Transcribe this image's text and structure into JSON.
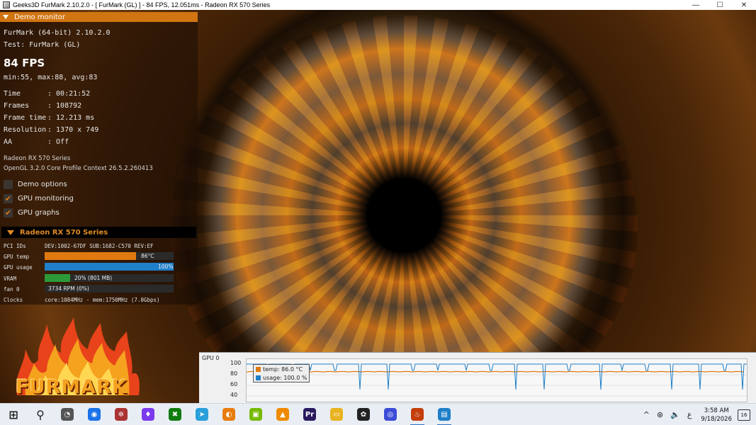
{
  "window": {
    "title": "Geeks3D FurMark 2.10.2.0 - [ FurMark (GL) ] - 84 FPS, 12.051ms - Radeon RX 570 Series",
    "minimize_glyph": "—",
    "maximize_glyph": "☐",
    "close_glyph": "✕"
  },
  "panel": {
    "header": "Demo monitor",
    "app_line": "FurMark (64-bit) 2.10.2.0",
    "test_line": "Test: FurMark (GL)",
    "fps": "84 FPS",
    "fps_stats": "min:55, max:88, avg:83",
    "stats": [
      {
        "label": "Time",
        "value": ": 00:21:52"
      },
      {
        "label": "Frames",
        "value": ": 108792"
      },
      {
        "label": "Frame time",
        "value": ": 12.213 ms"
      },
      {
        "label": "Resolution",
        "value": ": 1370 x 749"
      },
      {
        "label": "AA",
        "value": ": Off"
      }
    ],
    "gpu_name": "Radeon RX 570 Series",
    "opengl": "OpenGL 3.2.0 Core Profile Context 26.5.2.260413",
    "options": [
      {
        "label": "Demo options",
        "checked": false,
        "check_glyph": ""
      },
      {
        "label": "GPU monitoring",
        "checked": true,
        "check_glyph": "✔"
      },
      {
        "label": "GPU graphs",
        "checked": true,
        "check_glyph": "✔"
      }
    ]
  },
  "gpu_section": {
    "title": "Radeon RX 570 Series",
    "pci_label": "PCI IDs",
    "pci_value": "DEV:1002-67DF SUB:1682-C570 REV:EF",
    "temp_label": "GPU temp",
    "temp_value": "86°C",
    "temp_fraction": 0.71,
    "usage_label": "GPU usage",
    "usage_value": "100%",
    "usage_fraction": 1.0,
    "vram_label": "VRAM",
    "vram_value": "20% (801 MB)",
    "vram_fraction": 0.2,
    "fan_label": "fan 0",
    "fan_value": "3734 RPM (0%)",
    "clocks_label": "Clocks",
    "clocks_value": "core:1084MHz - mem:1750MHz (7.0Gbps)",
    "colors": {
      "temp": "#e07a10",
      "usage": "#1f7fc8",
      "vram": "#2d9a3a"
    }
  },
  "logo": {
    "text": "FURMARK"
  },
  "graph": {
    "title": "GPU 0",
    "yticks": [
      "100",
      "80",
      "60",
      "40"
    ],
    "legend": [
      {
        "label": "temp: 86.0 °C",
        "color": "#e07a10"
      },
      {
        "label": "usage: 100.0 %",
        "color": "#1f7fc8"
      }
    ]
  },
  "taskbar": {
    "apps": [
      {
        "name": "windows-start-icon",
        "glyph": "⊞",
        "color": "#1e1e1e"
      },
      {
        "name": "search-icon",
        "glyph": "⚲",
        "color": "#1e1e1e"
      },
      {
        "name": "task-manager-icon",
        "glyph": "◔",
        "color": "#555"
      },
      {
        "name": "browser-icon",
        "glyph": "◉",
        "color": "#1a73e8"
      },
      {
        "name": "app-gear-icon",
        "glyph": "✲",
        "color": "#a33"
      },
      {
        "name": "crystal-icon",
        "glyph": "♦",
        "color": "#7c3aed"
      },
      {
        "name": "xbox-icon",
        "glyph": "✖",
        "color": "#107c10"
      },
      {
        "name": "telegram-icon",
        "glyph": "➤",
        "color": "#2aa0da"
      },
      {
        "name": "blender-icon",
        "glyph": "◐",
        "color": "#e87d0d"
      },
      {
        "name": "gpu-tool-icon",
        "glyph": "▣",
        "color": "#76b900"
      },
      {
        "name": "vlc-icon",
        "glyph": "▲",
        "color": "#f08a00"
      },
      {
        "name": "premiere-icon",
        "glyph": "Pr",
        "color": "#2a1a5e"
      },
      {
        "name": "file-explorer-icon",
        "glyph": "▭",
        "color": "#e8b320"
      },
      {
        "name": "chatgpt-icon",
        "glyph": "✿",
        "color": "#222"
      },
      {
        "name": "obs-icon",
        "glyph": "◎",
        "color": "#3b4bd6"
      },
      {
        "name": "furmark-icon",
        "glyph": "♨",
        "color": "#c43d0a"
      },
      {
        "name": "active-window-icon",
        "glyph": "▤",
        "color": "#1f7fc8"
      }
    ],
    "tray_glyphs": [
      "^",
      "⊛",
      "🔈",
      "ع"
    ],
    "time": "3:58 AM",
    "date": "9/18/2026",
    "notifications": "16"
  }
}
